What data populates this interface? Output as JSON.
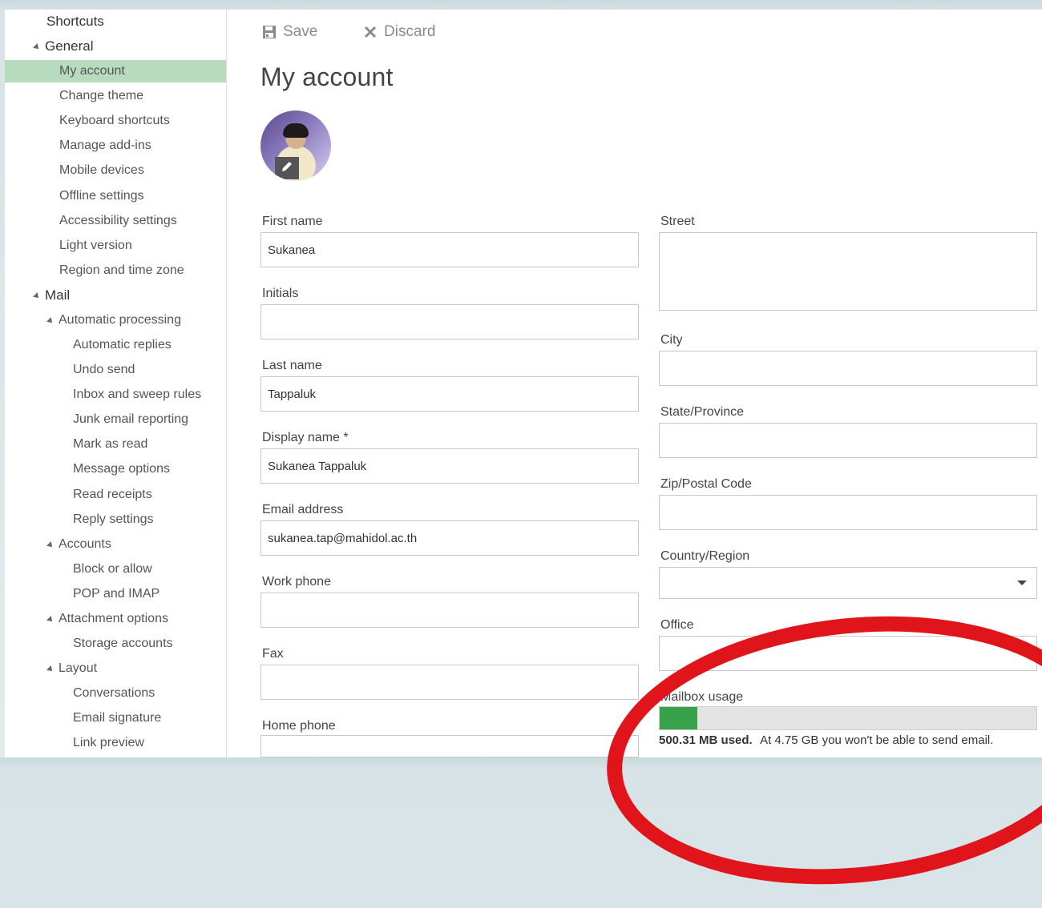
{
  "toolbar": {
    "save_label": "Save",
    "discard_label": "Discard"
  },
  "page_title": "My account",
  "sidebar": {
    "items": [
      {
        "label": "Shortcuts",
        "level": 0,
        "expandable": false
      },
      {
        "label": "General",
        "level": 0,
        "expandable": true
      },
      {
        "label": "My account",
        "level": 1,
        "selected": true
      },
      {
        "label": "Change theme",
        "level": 1
      },
      {
        "label": "Keyboard shortcuts",
        "level": 1
      },
      {
        "label": "Manage add-ins",
        "level": 1
      },
      {
        "label": "Mobile devices",
        "level": 1
      },
      {
        "label": "Offline settings",
        "level": 1
      },
      {
        "label": "Accessibility settings",
        "level": 1
      },
      {
        "label": "Light version",
        "level": 1
      },
      {
        "label": "Region and time zone",
        "level": 1
      },
      {
        "label": "Mail",
        "level": 0,
        "expandable": true
      },
      {
        "label": "Automatic processing",
        "level": 1,
        "expandable": true
      },
      {
        "label": "Automatic replies",
        "level": 2
      },
      {
        "label": "Undo send",
        "level": 2
      },
      {
        "label": "Inbox and sweep rules",
        "level": 2
      },
      {
        "label": "Junk email reporting",
        "level": 2
      },
      {
        "label": "Mark as read",
        "level": 2
      },
      {
        "label": "Message options",
        "level": 2
      },
      {
        "label": "Read receipts",
        "level": 2
      },
      {
        "label": "Reply settings",
        "level": 2
      },
      {
        "label": "Accounts",
        "level": 1,
        "expandable": true
      },
      {
        "label": "Block or allow",
        "level": 2
      },
      {
        "label": "POP and IMAP",
        "level": 2
      },
      {
        "label": "Attachment options",
        "level": 1,
        "expandable": true
      },
      {
        "label": "Storage accounts",
        "level": 2
      },
      {
        "label": "Layout",
        "level": 1,
        "expandable": true
      },
      {
        "label": "Conversations",
        "level": 2
      },
      {
        "label": "Email signature",
        "level": 2
      },
      {
        "label": "Link preview",
        "level": 2
      }
    ]
  },
  "form": {
    "first_name": {
      "label": "First name",
      "value": "Sukanea"
    },
    "initials": {
      "label": "Initials",
      "value": ""
    },
    "last_name": {
      "label": "Last name",
      "value": "Tappaluk"
    },
    "display_name": {
      "label": "Display name *",
      "value": "Sukanea Tappaluk"
    },
    "email": {
      "label": "Email address",
      "value": "sukanea.tap@mahidol.ac.th"
    },
    "work_phone": {
      "label": "Work phone",
      "value": ""
    },
    "fax": {
      "label": "Fax",
      "value": ""
    },
    "home_phone": {
      "label": "Home phone",
      "value": ""
    },
    "street": {
      "label": "Street",
      "value": ""
    },
    "city": {
      "label": "City",
      "value": ""
    },
    "state": {
      "label": "State/Province",
      "value": ""
    },
    "zip": {
      "label": "Zip/Postal Code",
      "value": ""
    },
    "country": {
      "label": "Country/Region",
      "value": ""
    },
    "office": {
      "label": "Office",
      "value": ""
    }
  },
  "mailbox": {
    "label": "Mailbox usage",
    "used": "500.31 MB used.",
    "note": "At 4.75 GB you won't be able to send email.",
    "usage_fraction": 0.1
  },
  "colors": {
    "selected_bg": "#b7dcbd",
    "usage_fill": "#37a249",
    "annotation": "#e0141b"
  }
}
